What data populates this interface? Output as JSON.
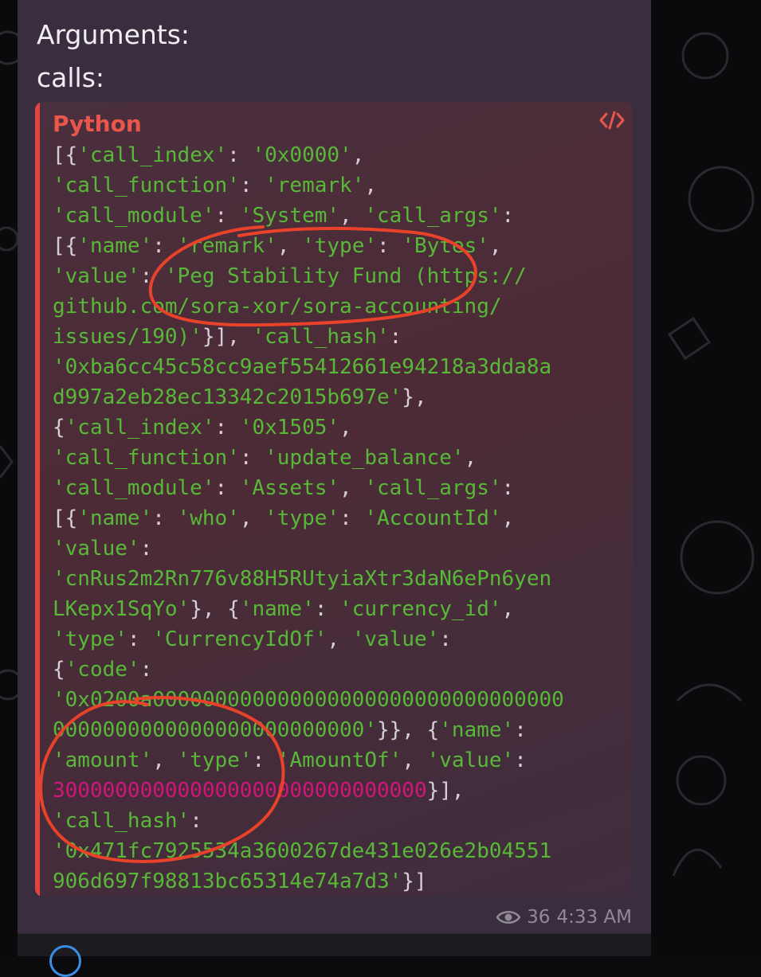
{
  "message": {
    "heading": "Arguments:",
    "subheading": "calls:"
  },
  "code": {
    "language": "Python",
    "copy_icon": "code-embed-icon",
    "lines": [
      [
        {
          "t": "p",
          "v": "[{"
        },
        {
          "t": "s",
          "v": "'call_index'"
        },
        {
          "t": "p",
          "v": ": "
        },
        {
          "t": "s",
          "v": "'0x0000'"
        },
        {
          "t": "p",
          "v": ","
        }
      ],
      [
        {
          "t": "s",
          "v": "'call_function'"
        },
        {
          "t": "p",
          "v": ": "
        },
        {
          "t": "s",
          "v": "'remark'"
        },
        {
          "t": "p",
          "v": ","
        }
      ],
      [
        {
          "t": "s",
          "v": "'call_module'"
        },
        {
          "t": "p",
          "v": ": "
        },
        {
          "t": "s",
          "v": "'System'"
        },
        {
          "t": "p",
          "v": ", "
        },
        {
          "t": "s",
          "v": "'call_args'"
        },
        {
          "t": "p",
          "v": ":"
        }
      ],
      [
        {
          "t": "p",
          "v": "[{"
        },
        {
          "t": "s",
          "v": "'name'"
        },
        {
          "t": "p",
          "v": ": "
        },
        {
          "t": "s",
          "v": "'remark'"
        },
        {
          "t": "p",
          "v": ", "
        },
        {
          "t": "s",
          "v": "'type'"
        },
        {
          "t": "p",
          "v": ": "
        },
        {
          "t": "s",
          "v": "'Bytes'"
        },
        {
          "t": "p",
          "v": ","
        }
      ],
      [
        {
          "t": "s",
          "v": "'value'"
        },
        {
          "t": "p",
          "v": ": "
        },
        {
          "t": "s",
          "v": "'Peg Stability Fund (https://"
        }
      ],
      [
        {
          "t": "s",
          "v": "github.com/sora-xor/sora-accounting/"
        }
      ],
      [
        {
          "t": "s",
          "v": "issues/190)'"
        },
        {
          "t": "p",
          "v": "}], "
        },
        {
          "t": "s",
          "v": "'call_hash'"
        },
        {
          "t": "p",
          "v": ":"
        }
      ],
      [
        {
          "t": "s",
          "v": "'0xba6cc45c58cc9aef55412661e94218a3dda8a"
        }
      ],
      [
        {
          "t": "s",
          "v": "d997a2eb28ec13342c2015b697e'"
        },
        {
          "t": "p",
          "v": "},"
        }
      ],
      [
        {
          "t": "p",
          "v": "{"
        },
        {
          "t": "s",
          "v": "'call_index'"
        },
        {
          "t": "p",
          "v": ": "
        },
        {
          "t": "s",
          "v": "'0x1505'"
        },
        {
          "t": "p",
          "v": ","
        }
      ],
      [
        {
          "t": "s",
          "v": "'call_function'"
        },
        {
          "t": "p",
          "v": ": "
        },
        {
          "t": "s",
          "v": "'update_balance'"
        },
        {
          "t": "p",
          "v": ","
        }
      ],
      [
        {
          "t": "s",
          "v": "'call_module'"
        },
        {
          "t": "p",
          "v": ": "
        },
        {
          "t": "s",
          "v": "'Assets'"
        },
        {
          "t": "p",
          "v": ", "
        },
        {
          "t": "s",
          "v": "'call_args'"
        },
        {
          "t": "p",
          "v": ":"
        }
      ],
      [
        {
          "t": "p",
          "v": "[{"
        },
        {
          "t": "s",
          "v": "'name'"
        },
        {
          "t": "p",
          "v": ": "
        },
        {
          "t": "s",
          "v": "'who'"
        },
        {
          "t": "p",
          "v": ", "
        },
        {
          "t": "s",
          "v": "'type'"
        },
        {
          "t": "p",
          "v": ": "
        },
        {
          "t": "s",
          "v": "'AccountId'"
        },
        {
          "t": "p",
          "v": ","
        }
      ],
      [
        {
          "t": "s",
          "v": "'value'"
        },
        {
          "t": "p",
          "v": ":"
        }
      ],
      [
        {
          "t": "s",
          "v": "'cnRus2m2Rn776v88H5RUtyiaXtr3daN6ePn6yen"
        }
      ],
      [
        {
          "t": "s",
          "v": "LKepx1SqYo'"
        },
        {
          "t": "p",
          "v": "}, {"
        },
        {
          "t": "s",
          "v": "'name'"
        },
        {
          "t": "p",
          "v": ": "
        },
        {
          "t": "s",
          "v": "'currency_id'"
        },
        {
          "t": "p",
          "v": ","
        }
      ],
      [
        {
          "t": "s",
          "v": "'type'"
        },
        {
          "t": "p",
          "v": ": "
        },
        {
          "t": "s",
          "v": "'CurrencyIdOf'"
        },
        {
          "t": "p",
          "v": ", "
        },
        {
          "t": "s",
          "v": "'value'"
        },
        {
          "t": "p",
          "v": ":"
        }
      ],
      [
        {
          "t": "p",
          "v": "{"
        },
        {
          "t": "s",
          "v": "'code'"
        },
        {
          "t": "p",
          "v": ":"
        }
      ],
      [
        {
          "t": "s",
          "v": "'0x0200a000000000000000000000000000000000"
        }
      ],
      [
        {
          "t": "s",
          "v": "0000000000000000000000000'"
        },
        {
          "t": "p",
          "v": "}}, {"
        },
        {
          "t": "s",
          "v": "'name'"
        },
        {
          "t": "p",
          "v": ":"
        }
      ],
      [
        {
          "t": "s",
          "v": "'amount'"
        },
        {
          "t": "p",
          "v": ", "
        },
        {
          "t": "s",
          "v": "'type'"
        },
        {
          "t": "p",
          "v": ": "
        },
        {
          "t": "s",
          "v": "'AmountOf'"
        },
        {
          "t": "p",
          "v": ", "
        },
        {
          "t": "s",
          "v": "'value'"
        },
        {
          "t": "p",
          "v": ":"
        }
      ],
      [
        {
          "t": "n",
          "v": "300000000000000000000000000000"
        },
        {
          "t": "p",
          "v": "}],"
        }
      ],
      [
        {
          "t": "s",
          "v": "'call_hash'"
        },
        {
          "t": "p",
          "v": ":"
        }
      ],
      [
        {
          "t": "s",
          "v": "'0x471fc7925534a3600267de431e026e2b04551"
        }
      ],
      [
        {
          "t": "s",
          "v": "906d697f98813bc65314e74a7d3'"
        },
        {
          "t": "p",
          "v": "}]"
        }
      ]
    ]
  },
  "footer": {
    "views": "36",
    "time": "4:33 AM",
    "views_icon": "eye-icon"
  },
  "colors": {
    "string": "#58b838",
    "number": "#d2157b",
    "punct": "#d6d0d6",
    "lang": "#e9574a",
    "annotation": "#e8432a"
  }
}
